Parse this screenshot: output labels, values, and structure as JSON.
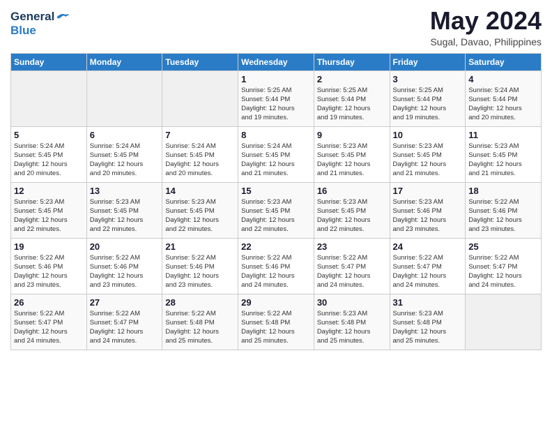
{
  "header": {
    "logo_general": "General",
    "logo_blue": "Blue",
    "month_title": "May 2024",
    "location": "Sugal, Davao, Philippines"
  },
  "weekdays": [
    "Sunday",
    "Monday",
    "Tuesday",
    "Wednesday",
    "Thursday",
    "Friday",
    "Saturday"
  ],
  "weeks": [
    [
      {
        "day": "",
        "info": ""
      },
      {
        "day": "",
        "info": ""
      },
      {
        "day": "",
        "info": ""
      },
      {
        "day": "1",
        "info": "Sunrise: 5:25 AM\nSunset: 5:44 PM\nDaylight: 12 hours\nand 19 minutes."
      },
      {
        "day": "2",
        "info": "Sunrise: 5:25 AM\nSunset: 5:44 PM\nDaylight: 12 hours\nand 19 minutes."
      },
      {
        "day": "3",
        "info": "Sunrise: 5:25 AM\nSunset: 5:44 PM\nDaylight: 12 hours\nand 19 minutes."
      },
      {
        "day": "4",
        "info": "Sunrise: 5:24 AM\nSunset: 5:44 PM\nDaylight: 12 hours\nand 20 minutes."
      }
    ],
    [
      {
        "day": "5",
        "info": "Sunrise: 5:24 AM\nSunset: 5:45 PM\nDaylight: 12 hours\nand 20 minutes."
      },
      {
        "day": "6",
        "info": "Sunrise: 5:24 AM\nSunset: 5:45 PM\nDaylight: 12 hours\nand 20 minutes."
      },
      {
        "day": "7",
        "info": "Sunrise: 5:24 AM\nSunset: 5:45 PM\nDaylight: 12 hours\nand 20 minutes."
      },
      {
        "day": "8",
        "info": "Sunrise: 5:24 AM\nSunset: 5:45 PM\nDaylight: 12 hours\nand 21 minutes."
      },
      {
        "day": "9",
        "info": "Sunrise: 5:23 AM\nSunset: 5:45 PM\nDaylight: 12 hours\nand 21 minutes."
      },
      {
        "day": "10",
        "info": "Sunrise: 5:23 AM\nSunset: 5:45 PM\nDaylight: 12 hours\nand 21 minutes."
      },
      {
        "day": "11",
        "info": "Sunrise: 5:23 AM\nSunset: 5:45 PM\nDaylight: 12 hours\nand 21 minutes."
      }
    ],
    [
      {
        "day": "12",
        "info": "Sunrise: 5:23 AM\nSunset: 5:45 PM\nDaylight: 12 hours\nand 22 minutes."
      },
      {
        "day": "13",
        "info": "Sunrise: 5:23 AM\nSunset: 5:45 PM\nDaylight: 12 hours\nand 22 minutes."
      },
      {
        "day": "14",
        "info": "Sunrise: 5:23 AM\nSunset: 5:45 PM\nDaylight: 12 hours\nand 22 minutes."
      },
      {
        "day": "15",
        "info": "Sunrise: 5:23 AM\nSunset: 5:45 PM\nDaylight: 12 hours\nand 22 minutes."
      },
      {
        "day": "16",
        "info": "Sunrise: 5:23 AM\nSunset: 5:45 PM\nDaylight: 12 hours\nand 22 minutes."
      },
      {
        "day": "17",
        "info": "Sunrise: 5:23 AM\nSunset: 5:46 PM\nDaylight: 12 hours\nand 23 minutes."
      },
      {
        "day": "18",
        "info": "Sunrise: 5:22 AM\nSunset: 5:46 PM\nDaylight: 12 hours\nand 23 minutes."
      }
    ],
    [
      {
        "day": "19",
        "info": "Sunrise: 5:22 AM\nSunset: 5:46 PM\nDaylight: 12 hours\nand 23 minutes."
      },
      {
        "day": "20",
        "info": "Sunrise: 5:22 AM\nSunset: 5:46 PM\nDaylight: 12 hours\nand 23 minutes."
      },
      {
        "day": "21",
        "info": "Sunrise: 5:22 AM\nSunset: 5:46 PM\nDaylight: 12 hours\nand 23 minutes."
      },
      {
        "day": "22",
        "info": "Sunrise: 5:22 AM\nSunset: 5:46 PM\nDaylight: 12 hours\nand 24 minutes."
      },
      {
        "day": "23",
        "info": "Sunrise: 5:22 AM\nSunset: 5:47 PM\nDaylight: 12 hours\nand 24 minutes."
      },
      {
        "day": "24",
        "info": "Sunrise: 5:22 AM\nSunset: 5:47 PM\nDaylight: 12 hours\nand 24 minutes."
      },
      {
        "day": "25",
        "info": "Sunrise: 5:22 AM\nSunset: 5:47 PM\nDaylight: 12 hours\nand 24 minutes."
      }
    ],
    [
      {
        "day": "26",
        "info": "Sunrise: 5:22 AM\nSunset: 5:47 PM\nDaylight: 12 hours\nand 24 minutes."
      },
      {
        "day": "27",
        "info": "Sunrise: 5:22 AM\nSunset: 5:47 PM\nDaylight: 12 hours\nand 24 minutes."
      },
      {
        "day": "28",
        "info": "Sunrise: 5:22 AM\nSunset: 5:48 PM\nDaylight: 12 hours\nand 25 minutes."
      },
      {
        "day": "29",
        "info": "Sunrise: 5:22 AM\nSunset: 5:48 PM\nDaylight: 12 hours\nand 25 minutes."
      },
      {
        "day": "30",
        "info": "Sunrise: 5:23 AM\nSunset: 5:48 PM\nDaylight: 12 hours\nand 25 minutes."
      },
      {
        "day": "31",
        "info": "Sunrise: 5:23 AM\nSunset: 5:48 PM\nDaylight: 12 hours\nand 25 minutes."
      },
      {
        "day": "",
        "info": ""
      }
    ]
  ]
}
